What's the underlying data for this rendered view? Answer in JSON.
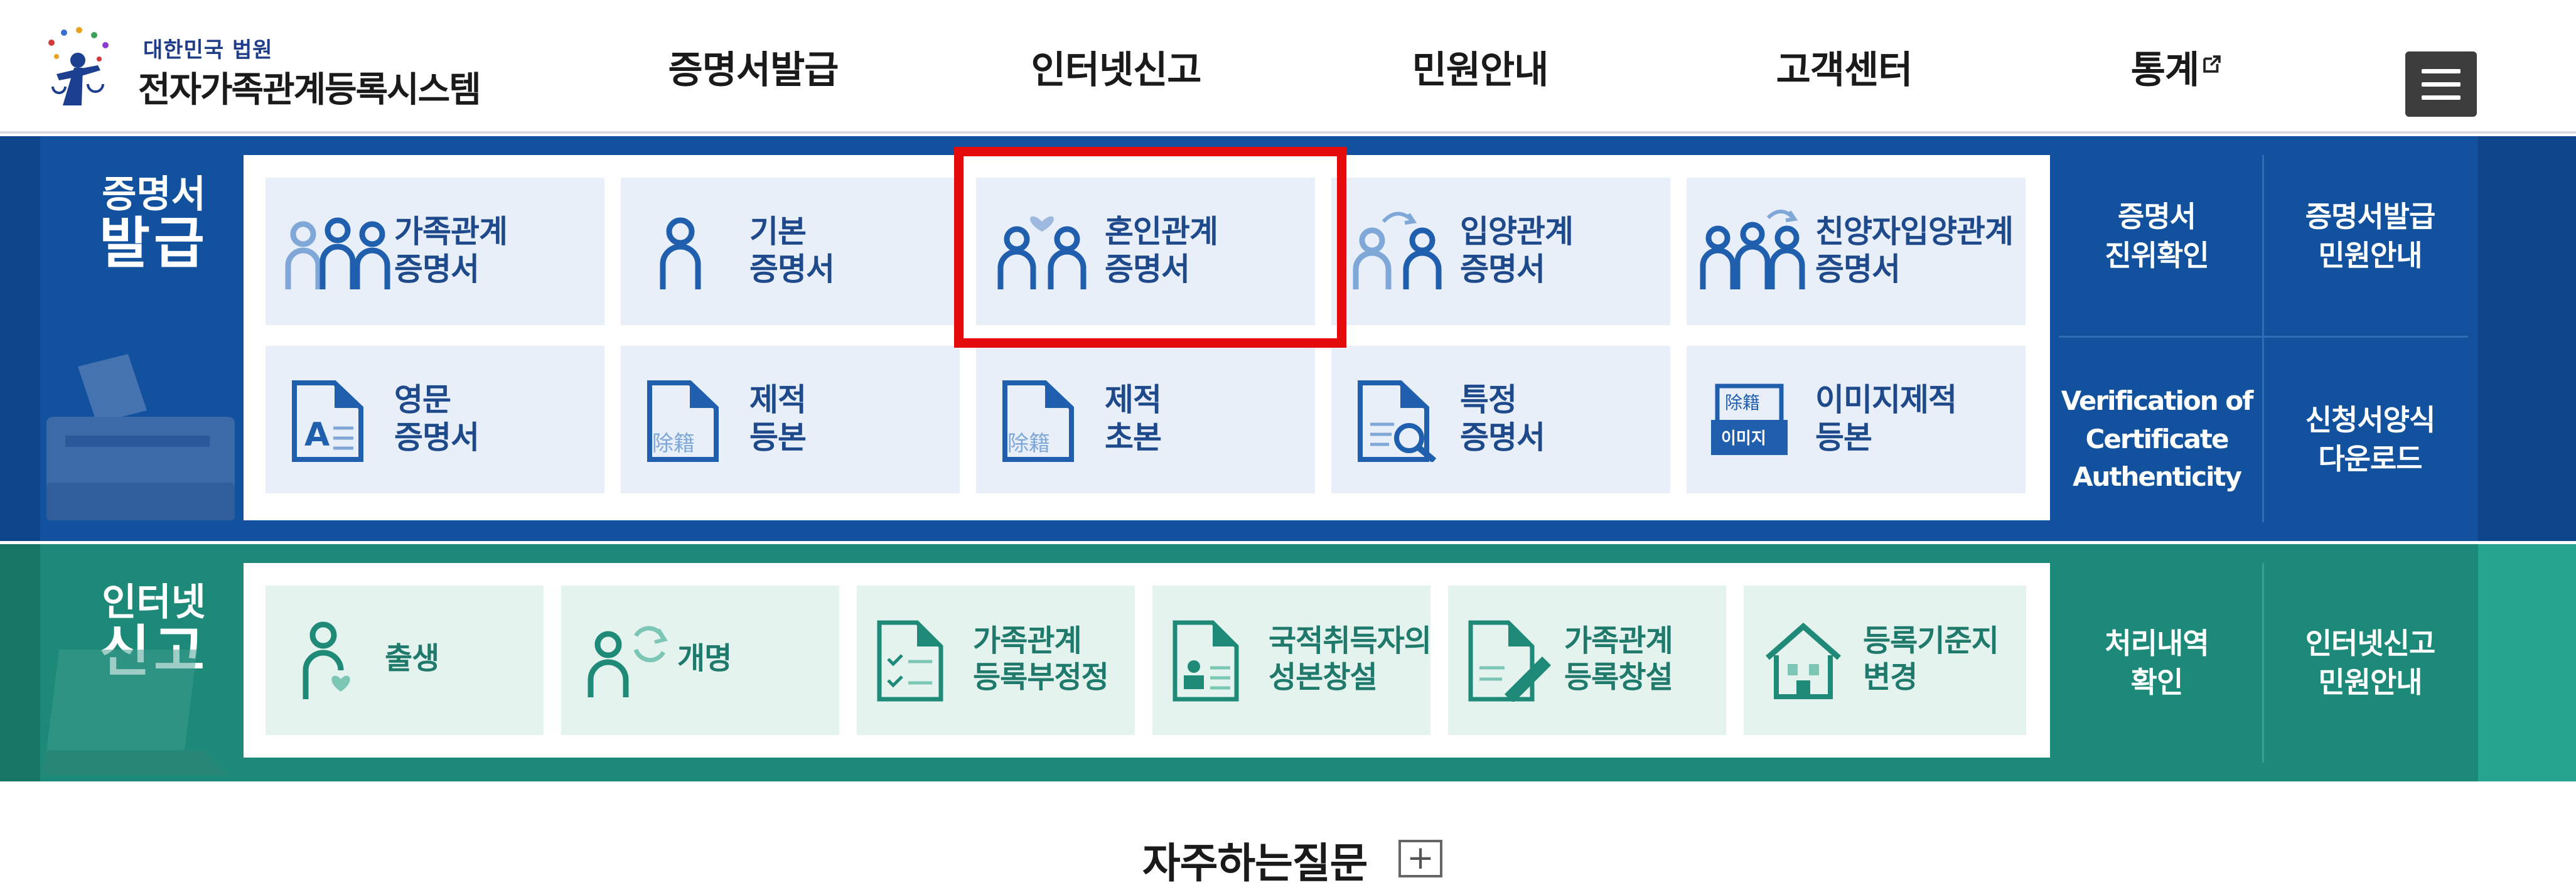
{
  "logo": {
    "small": "대한민국 법원",
    "big": "전자가족관계등록시스템"
  },
  "nav": [
    {
      "label": "증명서발급"
    },
    {
      "label": "인터넷신고"
    },
    {
      "label": "민원안내"
    },
    {
      "label": "고객센터"
    },
    {
      "label": "통계"
    }
  ],
  "cert": {
    "title_small": "증명서",
    "title_big": "발급",
    "tiles": [
      {
        "l1": "가족관계",
        "l2": "증명서",
        "icon": "family-icon"
      },
      {
        "l1": "기본",
        "l2": "증명서",
        "icon": "person-icon"
      },
      {
        "l1": "혼인관계",
        "l2": "증명서",
        "icon": "couple-heart-icon"
      },
      {
        "l1": "입양관계",
        "l2": "증명서",
        "icon": "adoption-icon"
      },
      {
        "l1": "친양자입양관계",
        "l2": "증명서",
        "icon": "family-adoption-icon"
      },
      {
        "l1": "영문",
        "l2": "증명서",
        "icon": "english-document-icon"
      },
      {
        "l1": "제적",
        "l2": "등본",
        "icon": "removal-document-icon"
      },
      {
        "l1": "제적",
        "l2": "초본",
        "icon": "removal-document-icon"
      },
      {
        "l1": "특정",
        "l2": "증명서",
        "icon": "document-search-icon"
      },
      {
        "l1": "이미지제적",
        "l2": "등본",
        "icon": "image-document-icon"
      }
    ],
    "icon_text": {
      "removal": "除籍",
      "image_top": "除籍",
      "image": "이미지"
    },
    "side": {
      "verify": "증명서\n진위확인",
      "guide": "증명서발급\n민원안내",
      "verify_en": "Verification of\nCertificate\nAuthenticity",
      "download": "신청서양식\n다운로드"
    }
  },
  "net": {
    "title_small": "인터넷",
    "title_big": "신고",
    "tiles": [
      {
        "l1": "출생",
        "l2": "",
        "icon": "birth-icon"
      },
      {
        "l1": "개명",
        "l2": "",
        "icon": "rename-icon"
      },
      {
        "l1": "가족관계",
        "l2": "등록부정정",
        "icon": "checklist-document-icon"
      },
      {
        "l1": "국적취득자의",
        "l2": "성본창설",
        "icon": "id-document-icon"
      },
      {
        "l1": "가족관계",
        "l2": "등록창설",
        "icon": "document-pen-icon"
      },
      {
        "l1": "등록기준지",
        "l2": "변경",
        "icon": "house-icon"
      }
    ],
    "side": {
      "status": "처리내역\n확인",
      "guide": "인터넷신고\n민원안내"
    }
  },
  "faq": {
    "title": "자주하는질문",
    "plus": "+"
  },
  "colors": {
    "cert_band": "#11519d",
    "net_band": "#1d8a79",
    "highlight": "#e30b0b",
    "icon_blue": "#1f5fae",
    "icon_light": "#7fa8d8",
    "icon_green": "#1f8a77"
  }
}
